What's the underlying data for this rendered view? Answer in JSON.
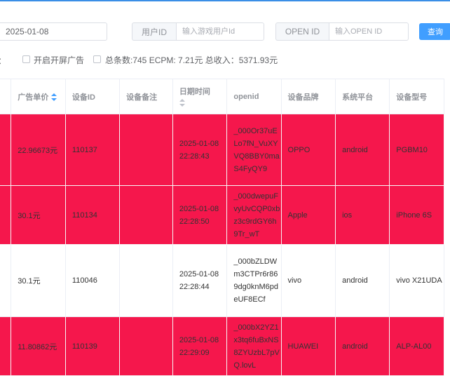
{
  "filters": {
    "date_value": "2025-01-08",
    "user_id_label": "用户ID",
    "user_id_placeholder": "输入游戏用户Id",
    "openid_label": "OPEN ID",
    "openid_placeholder": "输入OPEN ID",
    "search_label": "查询"
  },
  "options": {
    "colon": "：",
    "splash_ad_label": "开启开屏广告",
    "summary_label": "总条数:745 ECPM: 7.21元 总收入：5371.93元"
  },
  "table": {
    "columns": [
      "广告单价",
      "设备ID",
      "设备备注",
      "日期时间",
      "openid",
      "设备品牌",
      "系统平台",
      "设备型号"
    ],
    "rows": [
      {
        "highlight": true,
        "price": "22.96673元",
        "device_id": "110137",
        "note": "",
        "date": "2025-01-08",
        "time": "22:28:43",
        "openid": "_000Or37uELo7fN_VuXYVQ8BBY0maS4FyQY9",
        "brand": "OPPO",
        "platform": "android",
        "model": "PGBM10"
      },
      {
        "highlight": true,
        "price": "30.1元",
        "device_id": "110134",
        "note": "",
        "date": "2025-01-08",
        "time": "22:28:50",
        "openid": "_000dwepuFvyUvCQP0xbz3c9rdGY6h9Tr_wT",
        "brand": "Apple",
        "platform": "ios",
        "model": "iPhone 6S"
      },
      {
        "highlight": false,
        "price": "30.1元",
        "device_id": "110046",
        "note": "",
        "date": "2025-01-08",
        "time": "22:28:44",
        "openid": "_000bZLDWm3CTPr6r869dg0knM6pdeUF8ECf",
        "brand": "vivo",
        "platform": "android",
        "model": "vivo X21UDA"
      },
      {
        "highlight": true,
        "price": "11.80862元",
        "device_id": "110139",
        "note": "",
        "date": "2025-01-08",
        "time": "22:29:09",
        "openid": "_000bX2YZ1x3tq6fuBxNS8ZYUzbL7pVQ.lovL",
        "brand": "HUAWEI",
        "platform": "android",
        "model": "ALP-AL00"
      }
    ]
  },
  "colors": {
    "highlight_row": "#f5174c",
    "primary": "#409eff",
    "top_accent": "#3a8ee6"
  },
  "icons": {
    "sort_price": "sort-caret-icon",
    "sort_date": "sort-caret-icon"
  }
}
